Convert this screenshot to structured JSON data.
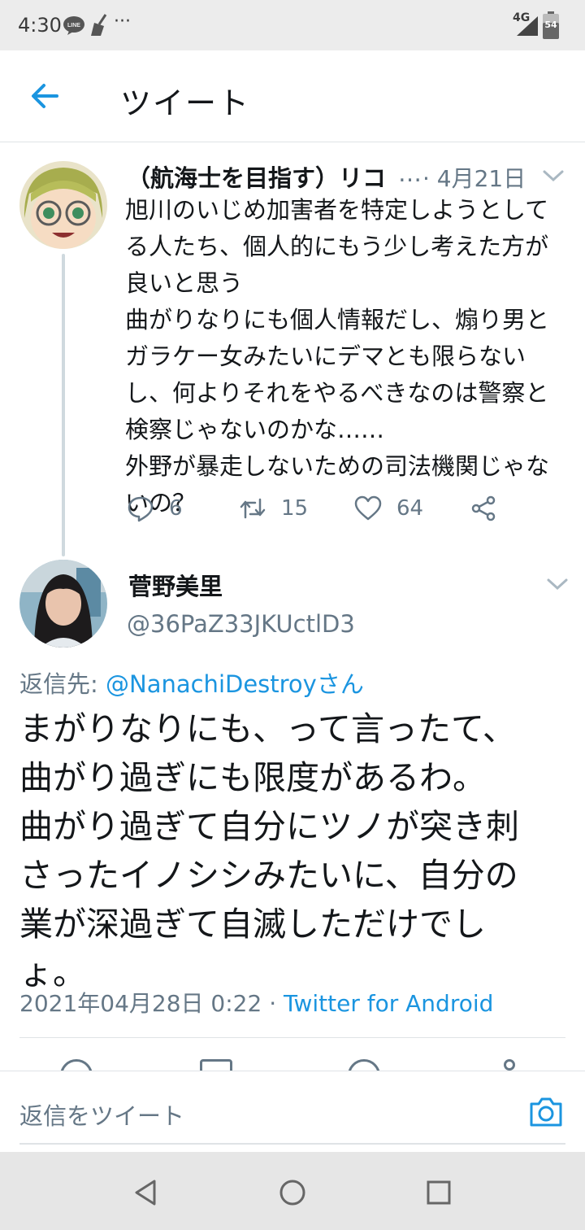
{
  "status_bar": {
    "time": "4:30",
    "line_label": "LINE",
    "more": "···",
    "network": "4G",
    "battery": "54"
  },
  "header": {
    "title": "ツイート"
  },
  "parent_tweet": {
    "display_name": "（航海士を目指す）リコ",
    "ellipsis": "…",
    "date": "· 4月21日",
    "lines": [
      "旭川のいじめ加害者を特定しようとして",
      "る人たち、個人的にもう少し考えた方が",
      "良いと思う",
      "曲がりなりにも個人情報だし、煽り男と",
      "ガラケー女みたいにデマとも限らない",
      "し、何よりそれをやるべきなのは警察と",
      "検察じゃないのかな……",
      "外野が暴走しないための司法機関じゃな",
      "いの？"
    ],
    "actions": {
      "reply_count": "6",
      "retweet_count": "15",
      "like_count": "64"
    }
  },
  "reply_tweet": {
    "display_name": "菅野美里",
    "handle": "@36PaZ33JKUctlD3",
    "reply_to_prefix": "返信先: ",
    "reply_to_mention": "@NanachiDestroyさん",
    "lines": [
      "まがりなりにも、って言ったて、",
      "曲がり過ぎにも限度があるわ。",
      "曲がり過ぎて自分にツノが突き刺",
      "さったイノシシみたいに、自分の",
      "業が深過ぎて自滅しただけでし",
      "ょ。"
    ],
    "timestamp": "2021年04月28日 0:22 · ",
    "client": "Twitter for Android"
  },
  "composer": {
    "placeholder": "返信をツイート"
  },
  "colors": {
    "accent": "#1b95e0",
    "muted": "#657786",
    "text": "#14171a",
    "divider": "#dfe3e6"
  },
  "icons": {
    "back": "arrow-left-icon",
    "chevron": "chevron-down-icon",
    "reply": "comment-icon",
    "retweet": "retweet-icon",
    "like": "heart-icon",
    "share": "share-icon",
    "camera": "camera-icon",
    "nav_back": "triangle-back-icon",
    "nav_home": "circle-home-icon",
    "nav_recents": "square-recents-icon"
  }
}
